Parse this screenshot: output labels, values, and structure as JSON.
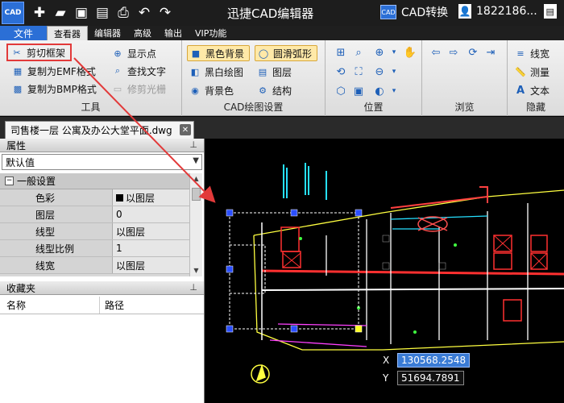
{
  "titlebar": {
    "logo_text": "CAD",
    "title": "迅捷CAD编辑器",
    "cad_convert": "CAD转换",
    "cad_convert_badge": "CAD",
    "user_phone": "1822186..."
  },
  "menu": {
    "file": "文件",
    "tabs": [
      "查看器",
      "编辑器",
      "高级",
      "输出",
      "VIP功能"
    ]
  },
  "ribbon": {
    "tools": {
      "label": "工具",
      "crop_frame": "剪切框架",
      "show_points": "显示点",
      "copy_emf": "复制为EMF格式",
      "find_text": "查找文字",
      "copy_bmp": "复制为BMP格式",
      "trim_raster": "修剪光栅"
    },
    "cad_settings": {
      "label": "CAD绘图设置",
      "black_bg": "黑色背景",
      "smooth_arc": "圆滑弧形",
      "bw_draw": "黑白绘图",
      "layers": "图层",
      "bg_color": "背景色",
      "structure": "结构"
    },
    "position": {
      "label": "位置"
    },
    "browse": {
      "label": "浏览"
    },
    "hide": {
      "label": "隐藏",
      "linewidth": "线宽",
      "measure": "测量",
      "text": "文本"
    }
  },
  "document": {
    "tab_title": "司售楼一层 公寓及办公大堂平面.dwg"
  },
  "properties": {
    "header": "属性",
    "dropdown_value": "默认值",
    "section": "一般设置",
    "rows": [
      {
        "key": "色彩",
        "value": "以图层"
      },
      {
        "key": "图层",
        "value": "0"
      },
      {
        "key": "线型",
        "value": "以图层"
      },
      {
        "key": "线型比例",
        "value": "1"
      },
      {
        "key": "线宽",
        "value": "以图层"
      }
    ]
  },
  "favorites": {
    "header": "收藏夹",
    "col_name": "名称",
    "col_path": "路径"
  },
  "coords": {
    "x_label": "X",
    "x_value": "130568.2548",
    "y_label": "Y",
    "y_value": "51694.7891"
  },
  "colors": {
    "accent": "#2b6fd6",
    "highlight_box": "#e23a3a",
    "canvas_bg": "#000000"
  }
}
